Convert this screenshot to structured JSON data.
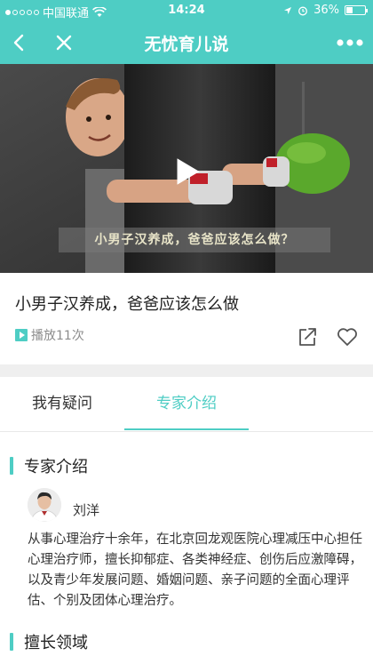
{
  "status_bar": {
    "carrier": "中国联通",
    "time": "14:24",
    "battery": "36%"
  },
  "nav": {
    "title": "无忧育儿说",
    "back_icon": "chevron-left-icon",
    "close_icon": "close-icon",
    "more_icon": "more-dots-icon"
  },
  "video": {
    "caption": "小男子汉养成，爸爸应该怎么做？"
  },
  "content": {
    "title": "小男子汉养成，爸爸应该怎么做",
    "play_count": "播放11次"
  },
  "tabs": [
    {
      "label": "我有疑问",
      "active": false
    },
    {
      "label": "专家介绍",
      "active": true
    }
  ],
  "expert": {
    "section_title": "专家介绍",
    "name": "刘洋",
    "bio": "从事心理治疗十余年，在北京回龙观医院心理减压中心担任心理治疗师，擅长抑郁症、各类神经症、创伤后应激障碍，以及青少年发展问题、婚姻问题、亲子问题的全面心理评估、个别及团体心理治疗。"
  },
  "specialty": {
    "section_title": "擅长领域"
  },
  "colors": {
    "accent": "#4ecdc4",
    "divider": "#efefef"
  }
}
